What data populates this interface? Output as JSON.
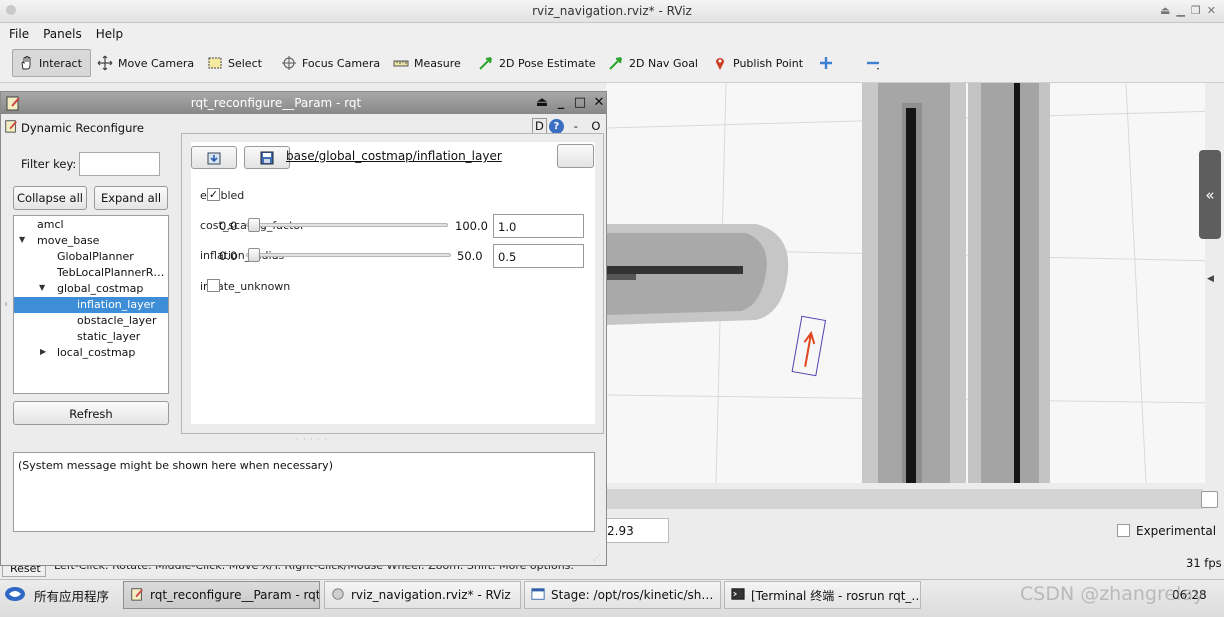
{
  "rviz": {
    "title": "rviz_navigation.rviz* - RViz",
    "menu": [
      "File",
      "Panels",
      "Help"
    ],
    "tools": [
      {
        "label": "Interact",
        "icon": "hand-pointer-icon"
      },
      {
        "label": "Move Camera",
        "icon": "move-camera-icon"
      },
      {
        "label": "Select",
        "icon": "select-box-icon"
      },
      {
        "label": "Focus Camera",
        "icon": "focus-target-icon"
      },
      {
        "label": "Measure",
        "icon": "ruler-icon"
      },
      {
        "label": "2D Pose Estimate",
        "icon": "green-arrow-icon"
      },
      {
        "label": "2D Nav Goal",
        "icon": "green-arrow-icon"
      },
      {
        "label": "Publish Point",
        "icon": "map-pin-icon"
      }
    ],
    "time_value": "2.93",
    "experimental_label": "Experimental",
    "fps": "31 fps",
    "reset_label": "Reset",
    "status_hint": "Left-Click: Rotate. Middle-Click: Move X/Y. Right-Click/Mouse Wheel: Zoom. Shift: More options."
  },
  "rqt": {
    "title": "rqt_reconfigure__Param - rqt",
    "plugin_title": "Dynamic Reconfigure",
    "plugin_ctl": {
      "d": "D",
      "help": "?",
      "minus": "-",
      "o": "O"
    },
    "filter_label": "Filter key:",
    "filter_value": "",
    "collapse_all": "Collapse all",
    "expand_all": "Expand all",
    "tree": [
      {
        "label": "amcl",
        "level": 1,
        "arrow": "",
        "selected": false
      },
      {
        "label": "move_base",
        "level": 1,
        "arrow": "down",
        "selected": false
      },
      {
        "label": "GlobalPlanner",
        "level": 2,
        "arrow": "",
        "selected": false
      },
      {
        "label": "TebLocalPlannerR…",
        "level": 2,
        "arrow": "",
        "selected": false
      },
      {
        "label": "global_costmap",
        "level": 2,
        "arrow": "down",
        "selected": false
      },
      {
        "label": "inflation_layer",
        "level": 3,
        "arrow": "",
        "selected": true
      },
      {
        "label": "obstacle_layer",
        "level": 3,
        "arrow": "",
        "selected": false
      },
      {
        "label": "static_layer",
        "level": 3,
        "arrow": "",
        "selected": false
      },
      {
        "label": "local_costmap",
        "level": 2,
        "arrow": "right",
        "selected": false
      }
    ],
    "refresh": "Refresh",
    "node_path": "base/global_costmap/inflation_layer",
    "params": {
      "enabled_label": "enabled",
      "enabled_checked": true,
      "cost_scaling_factor_label": "cost_scaling_factor",
      "cost_scaling_factor_min": "0.0",
      "cost_scaling_factor_max": "100.0",
      "cost_scaling_factor_value": "1.0",
      "cost_scaling_factor_level": 0.01,
      "inflation_radius_label": "inflation_radius",
      "inflation_radius_min": "0.0",
      "inflation_radius_max": "50.0",
      "inflation_radius_value": "0.5",
      "inflation_radius_level": 0.01,
      "inflate_unknown_label": "inflate_unknown",
      "inflate_unknown_checked": false
    },
    "system_message": "(System message might be shown here when necessary)"
  },
  "taskbar": {
    "start_label": "所有应用程序",
    "tasks": [
      "rqt_reconfigure__Param - rqt",
      "rviz_navigation.rviz* - RViz",
      "Stage: /opt/ros/kinetic/sh…",
      "[Terminal 终端 - rosrun rqt_…"
    ],
    "clock": "06:28",
    "watermark": "CSDN @zhangrelay"
  },
  "colors": {
    "selection": "#3d8ed6",
    "titlebar": "#8f8f8f",
    "goal_arrow": "#e0451d",
    "pose_frame": "#5a3fb0"
  }
}
